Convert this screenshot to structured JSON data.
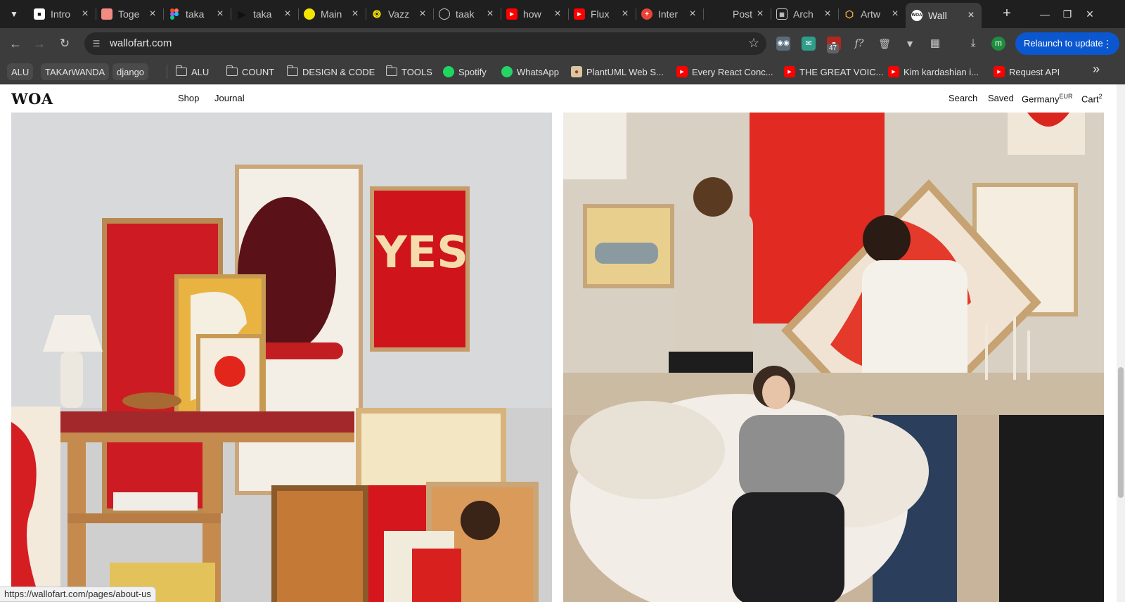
{
  "tabs": [
    {
      "title": "Intro",
      "favicon": "youtube-icon",
      "active": false
    },
    {
      "title": "Toge",
      "favicon": "image-icon",
      "active": false
    },
    {
      "title": "taka",
      "favicon": "figma-icon",
      "active": false
    },
    {
      "title": "taka",
      "favicon": "play-icon",
      "active": false
    },
    {
      "title": "Main",
      "favicon": "yellow-dot-icon",
      "active": false
    },
    {
      "title": "Vazz",
      "favicon": "vazzio-icon",
      "active": false
    },
    {
      "title": "taak",
      "favicon": "globe-icon",
      "active": false
    },
    {
      "title": "how",
      "favicon": "youtube-icon",
      "active": false
    },
    {
      "title": "Flux",
      "favicon": "youtube-icon",
      "active": false
    },
    {
      "title": "Inter",
      "favicon": "red-circle-icon",
      "active": false
    },
    {
      "title": "Post",
      "favicon": "",
      "active": false
    },
    {
      "title": "Arch",
      "favicon": "grid-icon",
      "active": false
    },
    {
      "title": "Artw",
      "favicon": "hex-icon",
      "active": false
    },
    {
      "title": "Wall",
      "favicon": "woa-icon",
      "active": true
    }
  ],
  "toolbar": {
    "url": "wallofart.com",
    "extension_badge": "47",
    "avatar_letter": "m",
    "relaunch_label": "Relaunch to update"
  },
  "bookmarks": [
    {
      "label": "ALU",
      "kind": "chip"
    },
    {
      "label": "TAKArWANDA",
      "kind": "chip"
    },
    {
      "label": "django",
      "kind": "chip"
    },
    {
      "label": "ALU",
      "kind": "folder"
    },
    {
      "label": "COUNT",
      "kind": "folder"
    },
    {
      "label": "DESIGN & CODE",
      "kind": "folder"
    },
    {
      "label": "TOOLS",
      "kind": "folder"
    },
    {
      "label": "Spotify",
      "kind": "spotify"
    },
    {
      "label": "WhatsApp",
      "kind": "whatsapp"
    },
    {
      "label": "PlantUML Web S...",
      "kind": "plantuml"
    },
    {
      "label": "Every React Conc...",
      "kind": "youtube"
    },
    {
      "label": "THE GREAT VOIC...",
      "kind": "youtube"
    },
    {
      "label": "Kim kardashian i...",
      "kind": "youtube"
    },
    {
      "label": "Request API",
      "kind": "youtube"
    }
  ],
  "site": {
    "logo": "WOA",
    "nav_left": [
      "Shop",
      "Journal"
    ],
    "search": "Search",
    "saved": "Saved",
    "region": "Germany",
    "currency": "EUR",
    "cart": "Cart",
    "cart_count": "2",
    "poster_text": "YES"
  },
  "status_url": "https://wallofart.com/pages/about-us",
  "colors": {
    "brand_red": "#d81f1f",
    "chrome_dark": "#1f1f1f",
    "toolbar": "#3c3c3c",
    "relaunch_blue": "#0b57d0"
  }
}
